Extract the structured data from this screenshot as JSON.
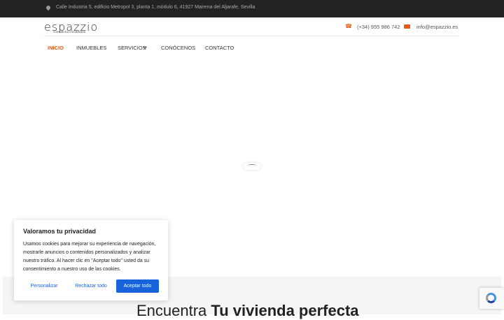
{
  "topbar": {
    "address": "Calle Industria 5, edificio Metropol 3, planta 1, módulo 6, 41927 Mairena del Aljarafe, Sevilla"
  },
  "header": {
    "logo_word": "espazzio",
    "logo_sub": "consultoría inmobiliaria",
    "phone": "(+34) 955 986 742",
    "email": "info@espazzio.es"
  },
  "nav": [
    {
      "label": "INICIO",
      "active": true
    },
    {
      "label": "INMUEBLES"
    },
    {
      "label": "SERVICIOS"
    },
    {
      "label": "CONÓCENOS"
    },
    {
      "label": "CONTACTO"
    }
  ],
  "hero": {
    "headline_light": "Encuentra ",
    "headline_bold": "Tu vivienda perfecta"
  },
  "cookie": {
    "title": "Valoramos tu privacidad",
    "text": "Usamos cookies para mejorar su experiencia de navegación, mostrarle anuncios o contenidos personalizados y analizar nuestro tráfico. Al hacer clic en \"Aceptar todo\" usted da su consentimiento a nuestro uso de las cookies.",
    "customize": "Personalizar",
    "reject": "Rechazar todo",
    "accept": "Aceptar todo"
  },
  "colors": {
    "accent": "#e55b13",
    "cookie_blue": "#1863dc",
    "topbar": "#222222"
  },
  "icons": [
    "map-pin-icon",
    "phone-icon",
    "mail-icon",
    "chevron-down-icon",
    "recaptcha-icon"
  ]
}
